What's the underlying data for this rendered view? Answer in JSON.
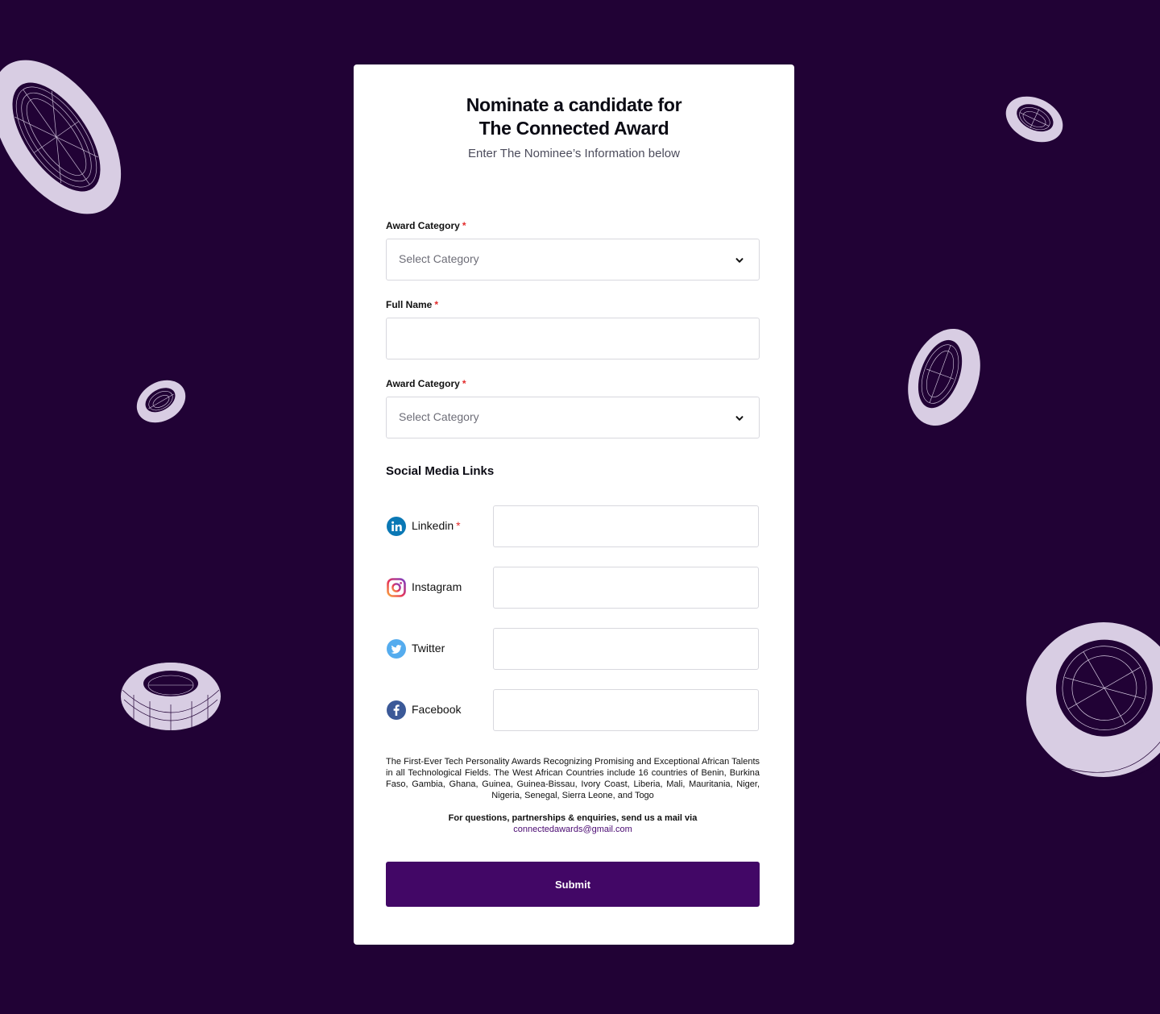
{
  "header": {
    "title_line1": "Nominate a candidate for",
    "title_line2": "The Connected Award",
    "subtitle": "Enter The Nominee’s Information below"
  },
  "form": {
    "award_category_1": {
      "label": "Award Category",
      "required_mark": "*",
      "value": "Select Category",
      "icon": "chevron-down-icon"
    },
    "full_name": {
      "label": "Full Name",
      "required_mark": "*",
      "value": ""
    },
    "award_category_2": {
      "label": "Award Category",
      "required_mark": "*",
      "value": "Select Category",
      "icon": "chevron-down-icon"
    },
    "social_section_title": "Social Media Links",
    "social": [
      {
        "label": "Linkedin",
        "required_mark": "*",
        "icon": "linkedin-icon",
        "value": ""
      },
      {
        "label": "Instagram",
        "required_mark": "",
        "icon": "instagram-icon",
        "value": ""
      },
      {
        "label": "Twitter",
        "required_mark": "",
        "icon": "twitter-icon",
        "value": ""
      },
      {
        "label": "Facebook",
        "required_mark": "",
        "icon": "facebook-icon",
        "value": ""
      }
    ]
  },
  "footer": {
    "about": "The First-Ever Tech Personality Awards Recognizing Promising and Exceptional African Talents in all Technological Fields. The West African Countries include 16 countries of Benin, Burkina Faso, Gambia, Ghana, Guinea, Guinea-Bissau, Ivory Coast, Liberia, Mali, Mauritania, Niger, Nigeria, Senegal, Sierra Leone, and Togo",
    "contact_text": "For questions, partnerships & enquiries, send us a mail via",
    "contact_email": "connectedawards@gmail.com",
    "submit_label": "Submit"
  },
  "colors": {
    "background": "#210235",
    "card": "#ffffff",
    "accent": "#420766",
    "required": "#e22a2a",
    "ring": "#d8cde3"
  }
}
